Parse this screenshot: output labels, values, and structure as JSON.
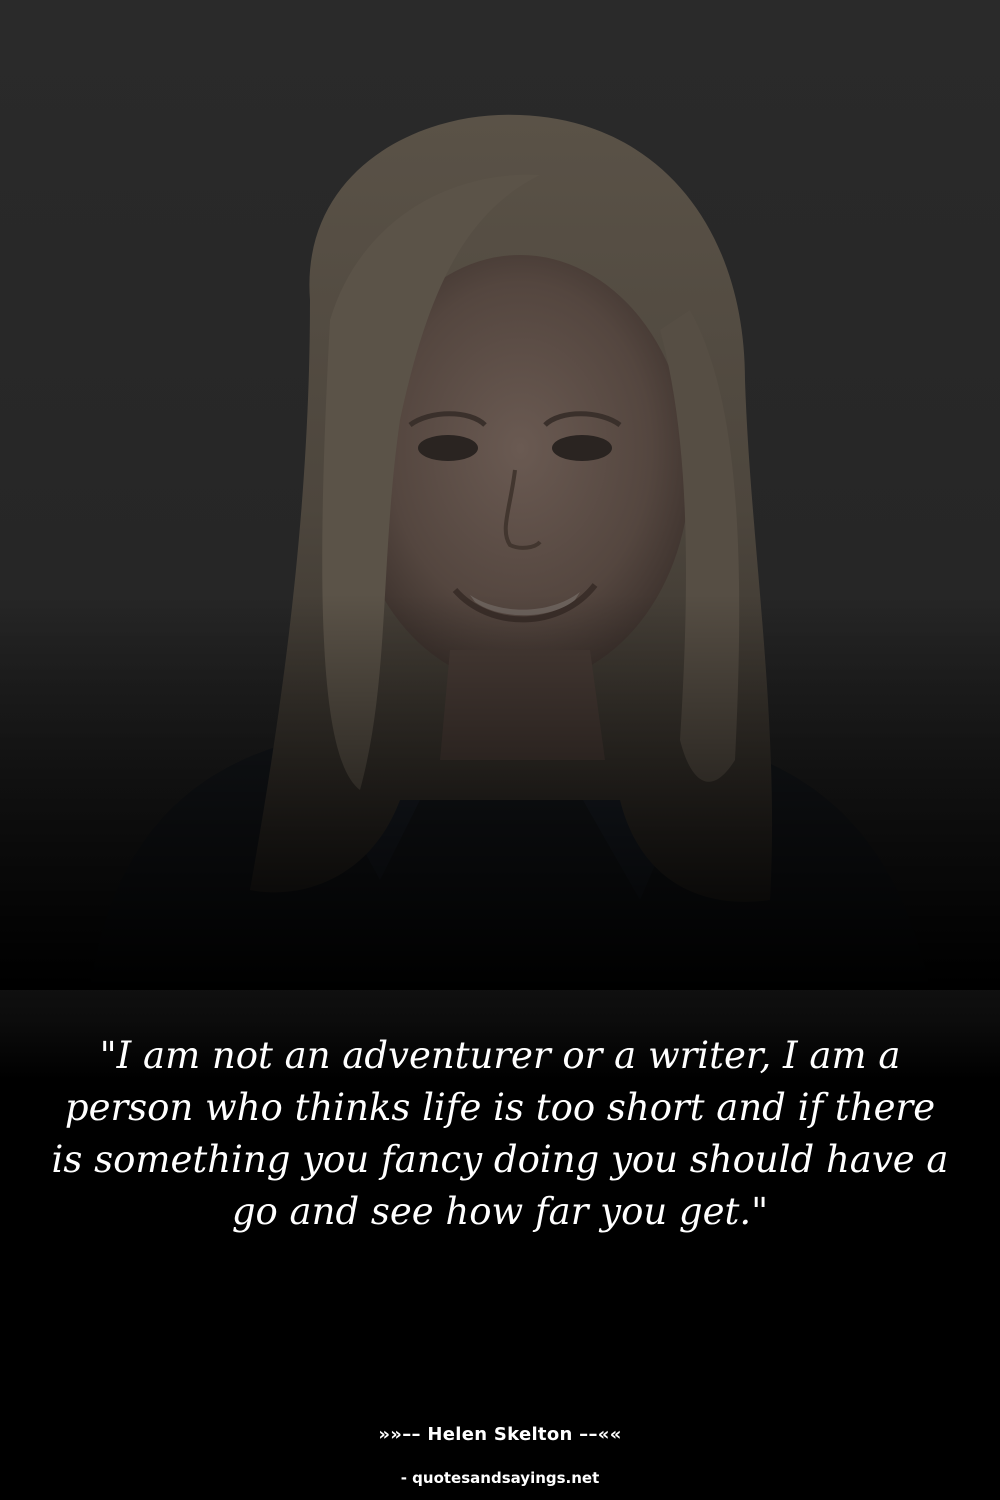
{
  "quote": {
    "text": "\"I am not an adventurer or a writer, I am a person who thinks life is too short and if there is something you fancy doing you should have a go and see how far you get.\""
  },
  "author": {
    "line": "»»–– Helen Skelton ––««"
  },
  "source": {
    "line": "- quotesandsayings.net"
  }
}
